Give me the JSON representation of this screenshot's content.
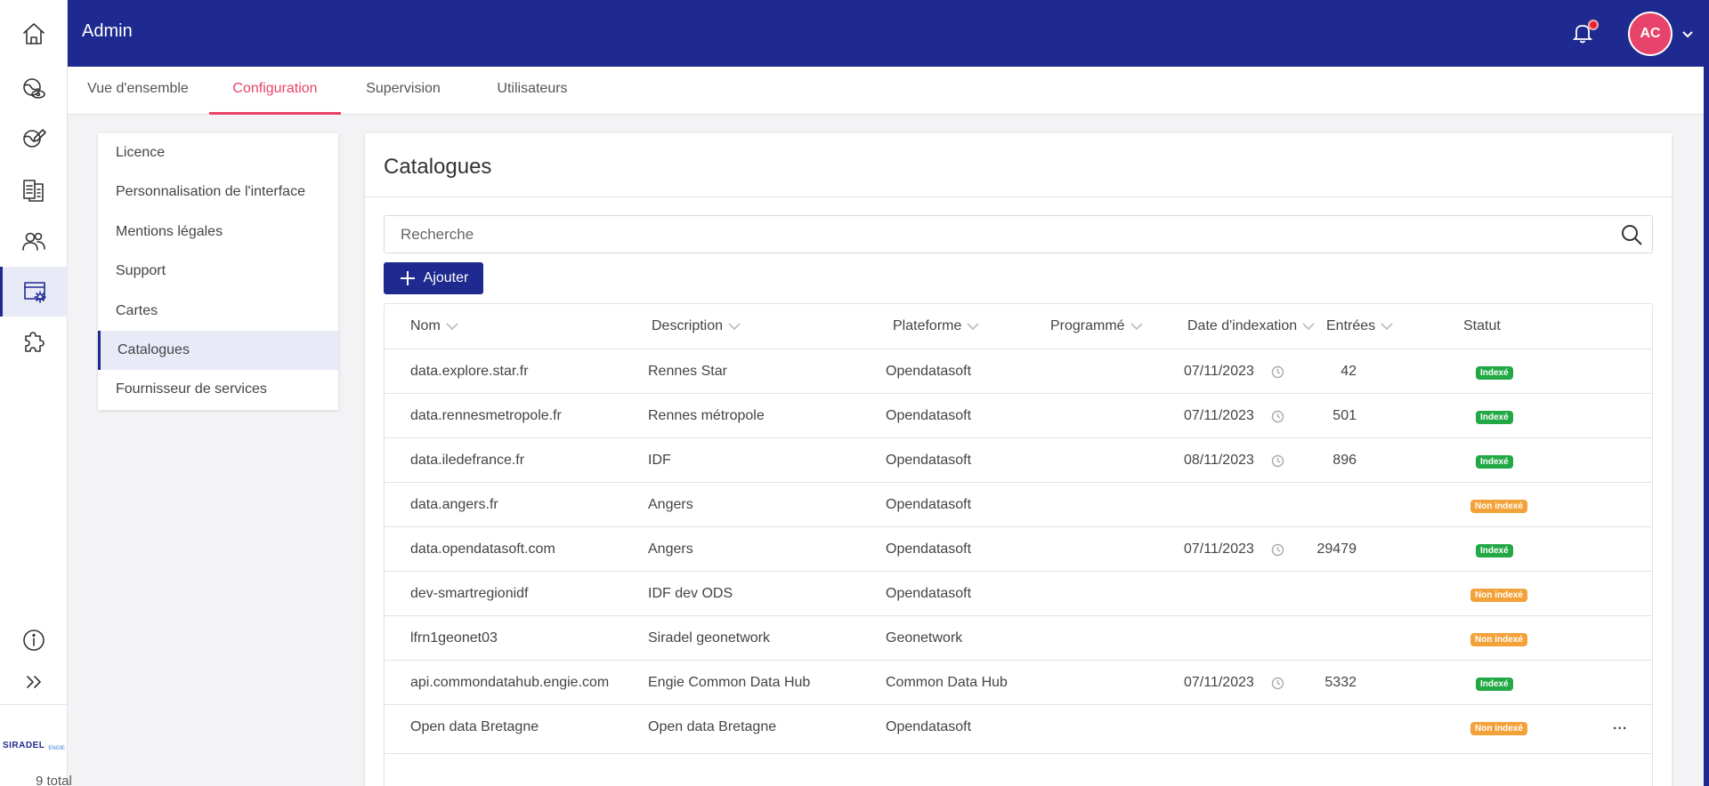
{
  "app": {
    "title": "Admin"
  },
  "user": {
    "initials": "AC"
  },
  "rail": {
    "items": [
      {
        "icon": "home-icon"
      },
      {
        "icon": "globe-eye-icon"
      },
      {
        "icon": "globe-edit-icon"
      },
      {
        "icon": "documents-icon"
      },
      {
        "icon": "users-icon"
      },
      {
        "icon": "admin-settings-icon",
        "active": true
      },
      {
        "icon": "puzzle-icon"
      }
    ],
    "bottom": [
      {
        "icon": "info-icon"
      },
      {
        "icon": "expand-icon"
      }
    ],
    "logo": {
      "text": "SIRADEL",
      "sub": "ENGIE"
    }
  },
  "tabs": [
    {
      "label": "Vue d'ensemble"
    },
    {
      "label": "Configuration",
      "active": true
    },
    {
      "label": "Supervision"
    },
    {
      "label": "Utilisateurs"
    }
  ],
  "menu": [
    {
      "label": "Licence"
    },
    {
      "label": "Personnalisation de l'interface"
    },
    {
      "label": "Mentions légales"
    },
    {
      "label": "Support"
    },
    {
      "label": "Cartes"
    },
    {
      "label": "Catalogues",
      "active": true
    },
    {
      "label": "Fournisseur de services"
    }
  ],
  "panel": {
    "title": "Catalogues",
    "search_placeholder": "Recherche",
    "add_label": "Ajouter",
    "total": "9 total"
  },
  "table": {
    "headers": {
      "nom": "Nom",
      "description": "Description",
      "plateforme": "Plateforme",
      "programme": "Programmé",
      "date": "Date d'indexation",
      "entrees": "Entrées",
      "statut": "Statut"
    },
    "rows": [
      {
        "nom": "data.explore.star.fr",
        "description": "Rennes Star",
        "plateforme": "Opendatasoft",
        "date": "07/11/2023",
        "entrees": "42",
        "statut": "Indexé",
        "indexed": true
      },
      {
        "nom": "data.rennesmetropole.fr",
        "description": "Rennes métropole",
        "plateforme": "Opendatasoft",
        "date": "07/11/2023",
        "entrees": "501",
        "statut": "Indexé",
        "indexed": true
      },
      {
        "nom": "data.iledefrance.fr",
        "description": "IDF",
        "plateforme": "Opendatasoft",
        "date": "08/11/2023",
        "entrees": "896",
        "statut": "Indexé",
        "indexed": true
      },
      {
        "nom": "data.angers.fr",
        "description": "Angers",
        "plateforme": "Opendatasoft",
        "date": "",
        "entrees": "",
        "statut": "Non indexé",
        "indexed": false
      },
      {
        "nom": "data.opendatasoft.com",
        "description": "Angers",
        "plateforme": "Opendatasoft",
        "date": "07/11/2023",
        "entrees": "29479",
        "statut": "Indexé",
        "indexed": true
      },
      {
        "nom": "dev-smartregionidf",
        "description": "IDF dev ODS",
        "plateforme": "Opendatasoft",
        "date": "",
        "entrees": "",
        "statut": "Non indexé",
        "indexed": false
      },
      {
        "nom": "lfrn1geonet03",
        "description": "Siradel geonetwork",
        "plateforme": "Geonetwork",
        "date": "",
        "entrees": "",
        "statut": "Non indexé",
        "indexed": false
      },
      {
        "nom": "api.commondatahub.engie.com",
        "description": "Engie Common Data Hub",
        "plateforme": "Common Data Hub",
        "date": "07/11/2023",
        "entrees": "5332",
        "statut": "Indexé",
        "indexed": true
      },
      {
        "nom": "Open data Bretagne",
        "description": "Open data Bretagne",
        "plateforme": "Opendatasoft",
        "date": "",
        "entrees": "",
        "statut": "Non indexé",
        "indexed": false,
        "more": "..."
      }
    ]
  },
  "colors": {
    "primary": "#1e2a8f",
    "accent": "#e8436a",
    "indexed": "#22a845",
    "not_indexed": "#f3a23a"
  }
}
